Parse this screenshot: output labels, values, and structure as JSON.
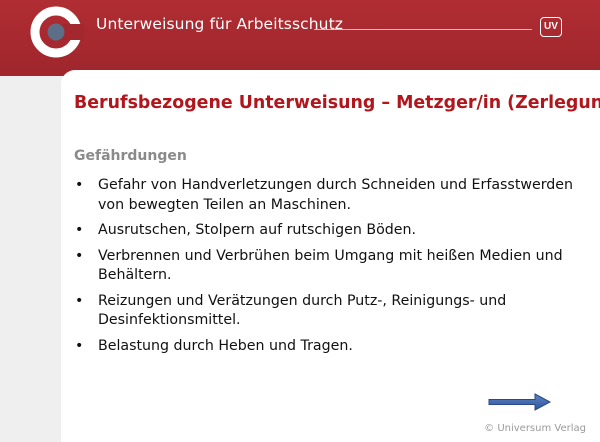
{
  "header": {
    "title": "Unterweisung für Arbeitsschutz",
    "badge": "UV"
  },
  "slide": {
    "title": "Berufsbezogene Unterweisung – Metzger/in (Zerlegung)",
    "subheading": "Gefährdungen",
    "bullets": [
      "Gefahr von Handverletzungen durch Schneiden und Erfasstwerden von bewegten Teilen an Maschinen.",
      "Ausrutschen, Stolpern auf rutschigen Böden.",
      "Verbrennen und Verbrühen beim Umgang mit heißen Medien und Behältern.",
      "Reizungen und Verätzungen durch Putz-, Reinigungs- und Desinfektionsmittel.",
      "Belastung durch Heben und Tragen."
    ]
  },
  "footer": {
    "copyright": "© Universum Verlag"
  },
  "colors": {
    "header_red": "#a3282e",
    "title_red": "#b1161c",
    "arrow_blue": "#3f6bb0"
  },
  "icons": {
    "logo": "universum-ring-logo",
    "badge": "uv-badge-icon",
    "next": "arrow-right-icon"
  }
}
